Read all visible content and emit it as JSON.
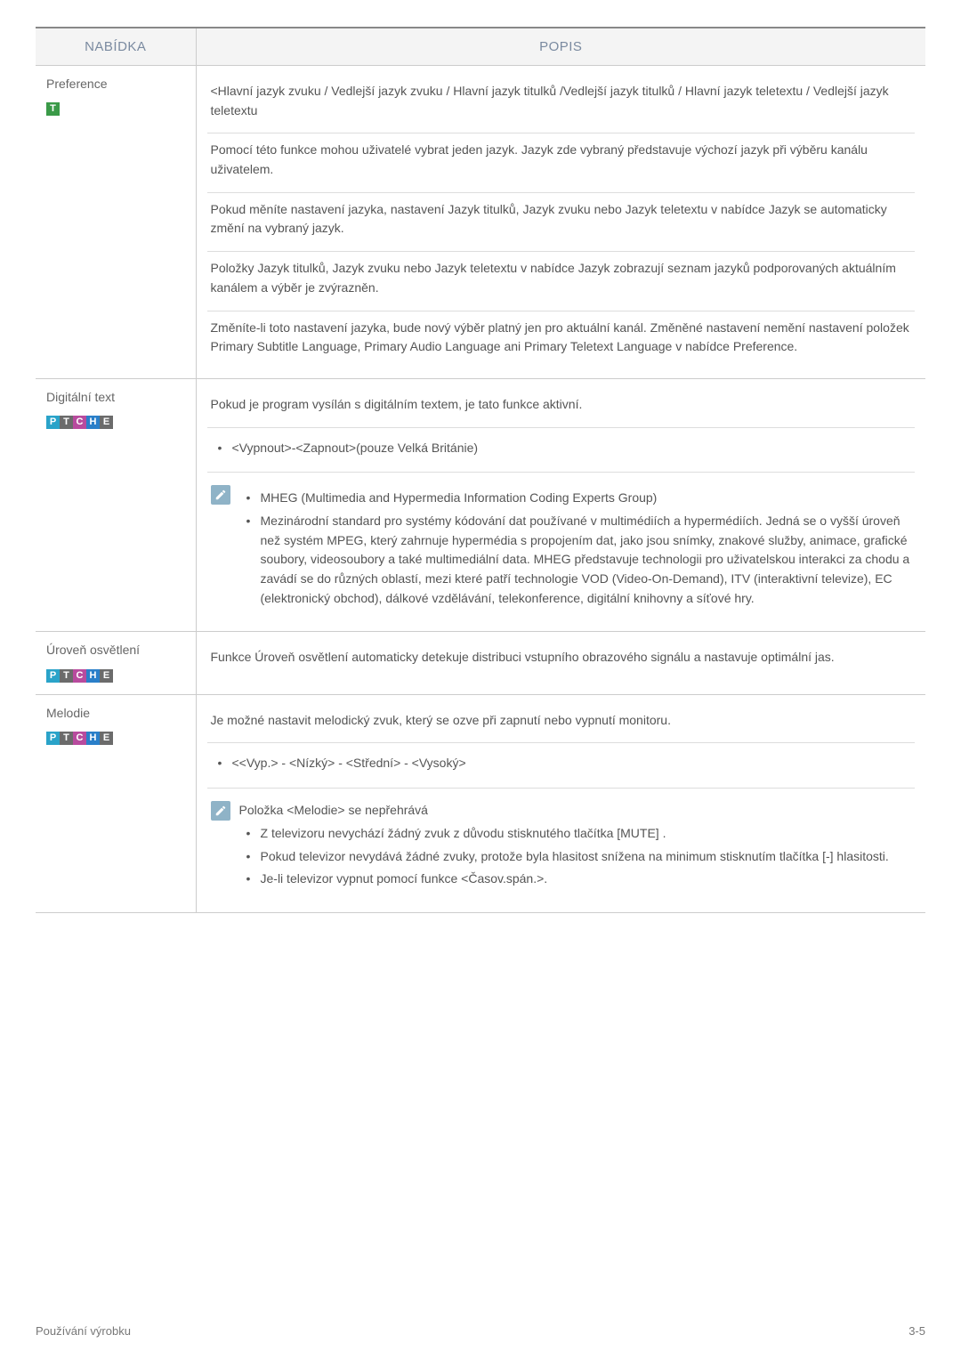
{
  "headers": {
    "menu": "NABÍDKA",
    "desc": "POPIS"
  },
  "rows": [
    {
      "title": "Preference",
      "badges": [
        "T-green"
      ],
      "blocks": [
        {
          "type": "para",
          "text": "<Hlavní jazyk zvuku / Vedlejší jazyk zvuku / Hlavní jazyk titulků /Vedlejší jazyk titulků / Hlavní jazyk teletextu / Vedlejší jazyk teletextu"
        },
        {
          "type": "para",
          "text": "Pomocí této funkce mohou uživatelé vybrat jeden jazyk. Jazyk zde vybraný představuje výchozí jazyk při výběru kanálu uživatelem."
        },
        {
          "type": "para",
          "text": "Pokud měníte nastavení jazyka, nastavení Jazyk titulků, Jazyk zvuku nebo Jazyk teletextu v nabídce Jazyk se automaticky změní na vybraný jazyk."
        },
        {
          "type": "para",
          "text": "Položky Jazyk titulků, Jazyk zvuku nebo Jazyk teletextu v nabídce Jazyk zobrazují seznam jazyků podporovaných aktuálním kanálem a výběr je zvýrazněn."
        },
        {
          "type": "para",
          "text": "Změníte-li toto nastavení jazyka, bude nový výběr platný jen pro aktuální kanál. Změněné nastavení nemění nastavení položek Primary Subtitle Language, Primary Audio Language ani Primary Teletext Language v nabídce Preference."
        }
      ]
    },
    {
      "title": "Digitální text",
      "badges": [
        "P",
        "T",
        "C",
        "H",
        "E"
      ],
      "blocks": [
        {
          "type": "para",
          "text": "Pokud je program vysílán s digitálním textem, je tato funkce aktivní."
        },
        {
          "type": "bullets",
          "items": [
            "<Vypnout>-<Zapnout>(pouze Velká Británie)"
          ]
        },
        {
          "type": "note",
          "items": [
            "MHEG (Multimedia and Hypermedia Information Coding Experts Group)",
            "Mezinárodní standard pro systémy kódování dat používané v multimédiích a hypermédiích. Jedná se o vyšší úroveň než systém MPEG, který zahrnuje hypermédia s propojením dat, jako jsou snímky, znakové služby, animace, grafické soubory, videosoubory a také multimediální data. MHEG představuje technologii pro uživatelskou interakci za chodu a zavádí se do různých oblastí, mezi které patří technologie VOD (Video-On-Demand), ITV (interaktivní televize), EC (elektronický obchod), dálkové vzdělávání, telekonference, digitální knihovny a síťové hry."
          ]
        }
      ]
    },
    {
      "title": "Úroveň osvětlení",
      "badges": [
        "P",
        "T",
        "C",
        "H",
        "E"
      ],
      "blocks": [
        {
          "type": "para",
          "text": "Funkce Úroveň osvětlení automaticky detekuje distribuci vstupního obrazového signálu a nastavuje optimální jas."
        }
      ]
    },
    {
      "title": "Melodie",
      "badges": [
        "P",
        "T",
        "C",
        "H",
        "E"
      ],
      "blocks": [
        {
          "type": "para",
          "text": "Je možné nastavit melodický zvuk, který se ozve při zapnutí nebo vypnutí monitoru."
        },
        {
          "type": "bullets",
          "items": [
            "<<Vyp.> - <Nízký> - <Střední> - <Vysoký>"
          ]
        },
        {
          "type": "note-lead",
          "lead": "Položka <Melodie> se nepřehrává",
          "items": [
            "Z televizoru nevychází žádný zvuk z důvodu stisknutého tlačítka [MUTE] .",
            "Pokud televizor nevydává žádné zvuky, protože byla hlasitost snížena na minimum stisknutím tlačítka [-] hlasitosti.",
            "Je-li televizor vypnut pomocí funkce <Časov.spán.>."
          ]
        }
      ]
    }
  ],
  "footer": {
    "left": "Používání výrobku",
    "right": "3-5"
  }
}
